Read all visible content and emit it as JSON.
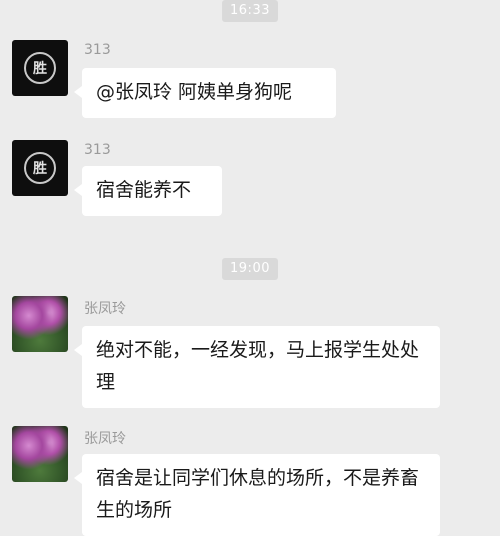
{
  "timestamps": [
    "16:33",
    "19:00"
  ],
  "messages": [
    {
      "sender": "313",
      "text": "@张凤玲 阿姨单身狗呢"
    },
    {
      "sender": "313",
      "text": "宿舍能养不"
    },
    {
      "sender": "张凤玲",
      "text": "绝对不能，一经发现，马上报学生处处理"
    },
    {
      "sender": "张凤玲",
      "text": "宿舍是让同学们休息的场所，不是养畜生的场所"
    }
  ],
  "avatar_313_glyph": "胜"
}
